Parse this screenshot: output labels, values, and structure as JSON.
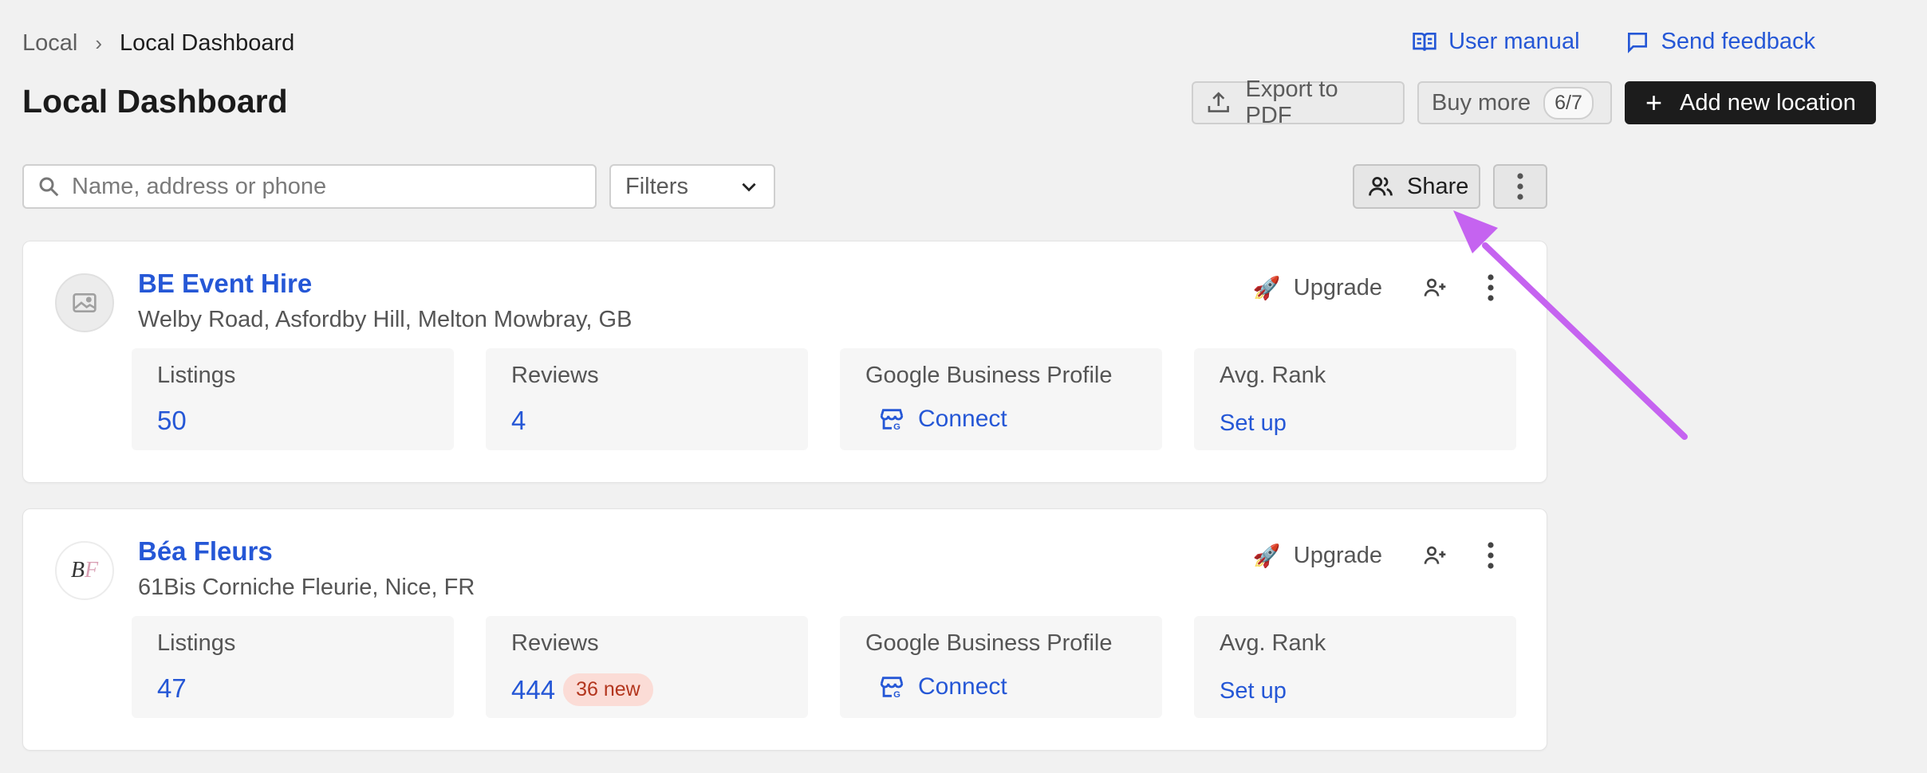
{
  "breadcrumb": {
    "root": "Local",
    "separator": "›",
    "current": "Local Dashboard"
  },
  "top_links": {
    "manual": "User manual",
    "feedback": "Send feedback"
  },
  "page_title": "Local Dashboard",
  "header": {
    "export_label": "Export to PDF",
    "buy_label": "Buy more",
    "buy_count": "6/7",
    "add_label": "Add new location",
    "add_icon": "+"
  },
  "toolbar": {
    "search_placeholder": "Name, address or phone",
    "search_value": "",
    "filters_label": "Filters",
    "share_label": "Share"
  },
  "locations": [
    {
      "name": "BE Event Hire",
      "address": "Welby Road, Asfordby Hill, Melton Mowbray, GB",
      "upgrade_label": "Upgrade",
      "listings_label": "Listings",
      "listings_value": "50",
      "reviews_label": "Reviews",
      "reviews_value": "4",
      "gbp_label": "Google Business Profile",
      "gbp_action": "Connect",
      "rank_label": "Avg. Rank",
      "rank_action": "Set up"
    },
    {
      "name": "Béa Fleurs",
      "address": "61Bis Corniche Fleurie, Nice, FR",
      "upgrade_label": "Upgrade",
      "listings_label": "Listings",
      "listings_value": "47",
      "reviews_label": "Reviews",
      "reviews_value": "444",
      "reviews_new": "36 new",
      "gbp_label": "Google Business Profile",
      "gbp_action": "Connect",
      "rank_label": "Avg. Rank",
      "rank_action": "Set up"
    }
  ],
  "colors": {
    "accent": "#2557d6",
    "background": "#f1f1f1",
    "primary_button": "#1c1c1c",
    "new_badge_bg": "#fbdcd6",
    "new_badge_text": "#b3361e",
    "annotation_arrow": "#c563f0"
  }
}
